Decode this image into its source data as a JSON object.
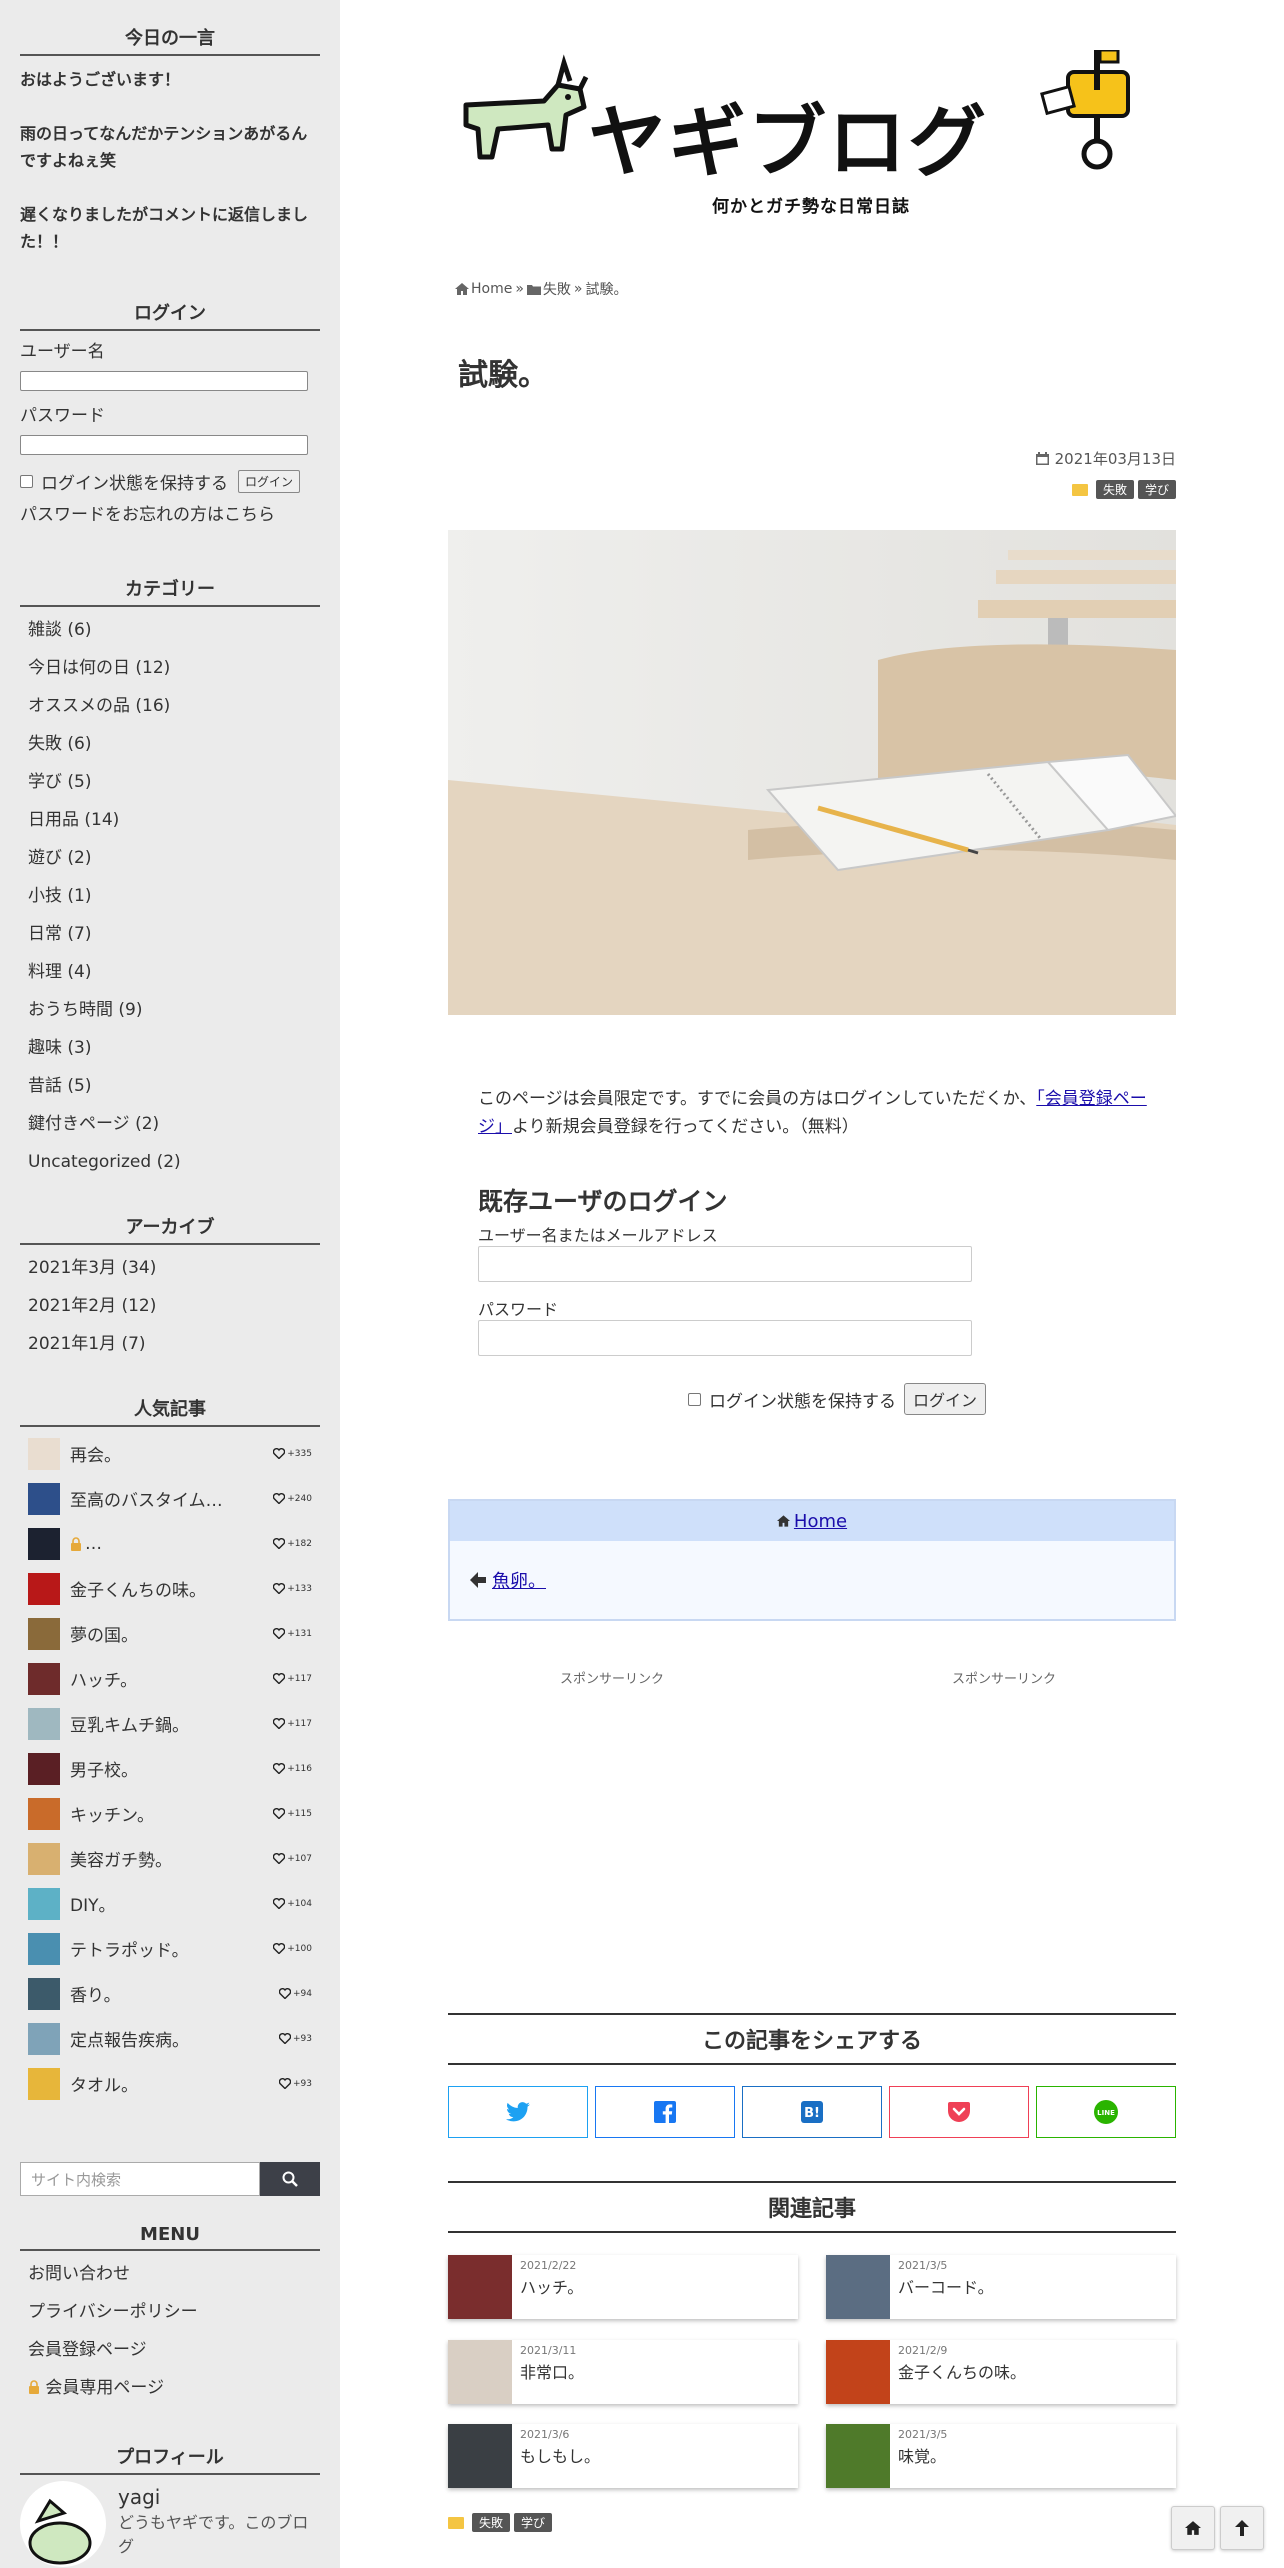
{
  "sidebar": {
    "hitokoto": {
      "title": "今日の一言",
      "p1": "おはようございます！",
      "p2": "雨の日ってなんだかテンションあがるんですよねぇ笑",
      "p3": "遅くなりましたがコメントに返信しました！！"
    },
    "login": {
      "title": "ログイン",
      "username_label": "ユーザー名",
      "password_label": "パスワード",
      "remember_label": "ログイン状態を保持する",
      "login_button": "ログイン",
      "forgot_link": "パスワードをお忘れの方はこちら"
    },
    "categories": {
      "title": "カテゴリー",
      "items": [
        "雑談 (6)",
        "今日は何の日 (12)",
        "オススメの品 (16)",
        "失敗 (6)",
        "学び (5)",
        "日用品 (14)",
        "遊び (2)",
        "小技 (1)",
        "日常 (7)",
        "料理 (4)",
        "おうち時間 (9)",
        "趣味 (3)",
        "昔話 (5)",
        "鍵付きページ (2)",
        "Uncategorized (2)"
      ]
    },
    "archive": {
      "title": "アーカイブ",
      "items": [
        "2021年3月 (34)",
        "2021年2月 (12)",
        "2021年1月 (7)"
      ]
    },
    "popular": {
      "title": "人気記事",
      "items": [
        {
          "title": "再会。",
          "count": "+335",
          "color": "#e9ddd0"
        },
        {
          "title": "至高のバスタイム…",
          "count": "+240",
          "color": "#2d4f8a"
        },
        {
          "title": "…",
          "count": "+182",
          "color": "#1c2230"
        },
        {
          "title": "金子くんちの味。",
          "count": "+133",
          "color": "#b81818"
        },
        {
          "title": "夢の国。",
          "count": "+131",
          "color": "#8a6a3a"
        },
        {
          "title": "ハッチ。",
          "count": "+117",
          "color": "#6e2b2b"
        },
        {
          "title": "豆乳キムチ鍋。",
          "count": "+117",
          "color": "#9fb8c0"
        },
        {
          "title": "男子校。",
          "count": "+116",
          "color": "#5a1f24"
        },
        {
          "title": "キッチン。",
          "count": "+115",
          "color": "#c96b2a"
        },
        {
          "title": "美容ガチ勢。",
          "count": "+107",
          "color": "#d8b070"
        },
        {
          "title": "DIY。",
          "count": "+104",
          "color": "#5db1c6"
        },
        {
          "title": "テトラポッド。",
          "count": "+100",
          "color": "#4a8fb0"
        },
        {
          "title": "香り。",
          "count": "+94",
          "color": "#3c5a6a"
        },
        {
          "title": "定点報告疾病。",
          "count": "+93",
          "color": "#7fa3b8"
        },
        {
          "title": "タオル。",
          "count": "+93",
          "color": "#e7b63a"
        }
      ]
    },
    "search": {
      "placeholder": "サイト内検索"
    },
    "menu": {
      "title": "MENU",
      "items": [
        "お問い合わせ",
        "プライバシーポリシー",
        "会員登録ページ",
        "会員専用ページ"
      ]
    },
    "profile": {
      "title": "プロフィール",
      "name": "yagi",
      "desc": "どうもヤギです。このブログ"
    }
  },
  "header": {
    "logo_text": "ヤギブログ",
    "tagline": "何かとガチ勢な日常日誌"
  },
  "breadcrumb": {
    "home": "Home",
    "category": "失敗",
    "current": "試験。"
  },
  "post": {
    "title": "試験。",
    "date": "2021年03月13日",
    "tags": [
      "失敗",
      "学び"
    ]
  },
  "members": {
    "notice_before": "このページは会員限定です。すでに会員の方はログインしていただくか、",
    "notice_link": "「会員登録ページ」",
    "notice_after": "より新規会員登録を行ってください。（無料）",
    "heading": "既存ユーザのログイン",
    "user_label": "ユーザー名またはメールアドレス",
    "pass_label": "パスワード",
    "remember_label": "ログイン状態を保持する",
    "login_button": "ログイン"
  },
  "post_nav": {
    "home": "Home",
    "prev": "魚卵。"
  },
  "sponsor": {
    "left": "スポンサーリンク",
    "right": "スポンサーリンク"
  },
  "share": {
    "title": "この記事をシェアする"
  },
  "related": {
    "title": "関連記事",
    "items": [
      {
        "date": "2021/2/22",
        "title": "ハッチ。",
        "color": "#7a2d2d"
      },
      {
        "date": "2021/3/5",
        "title": "バーコード。",
        "color": "#5b6d82"
      },
      {
        "date": "2021/3/11",
        "title": "非常口。",
        "color": "#d9cfc4"
      },
      {
        "date": "2021/2/9",
        "title": "金子くんちの味。",
        "color": "#c2431a"
      },
      {
        "date": "2021/3/6",
        "title": "もしもし。",
        "color": "#3a3f44"
      },
      {
        "date": "2021/3/5",
        "title": "味覚。",
        "color": "#4f7a2a"
      }
    ]
  },
  "footer_tags": [
    "失敗",
    "学び"
  ],
  "colors": {
    "accent_blue": "#cfe0fa",
    "twitter": "#1da1f2",
    "facebook": "#1877f2",
    "hatena": "#1a6fc4",
    "pocket": "#ef4056",
    "line": "#2ab400"
  }
}
